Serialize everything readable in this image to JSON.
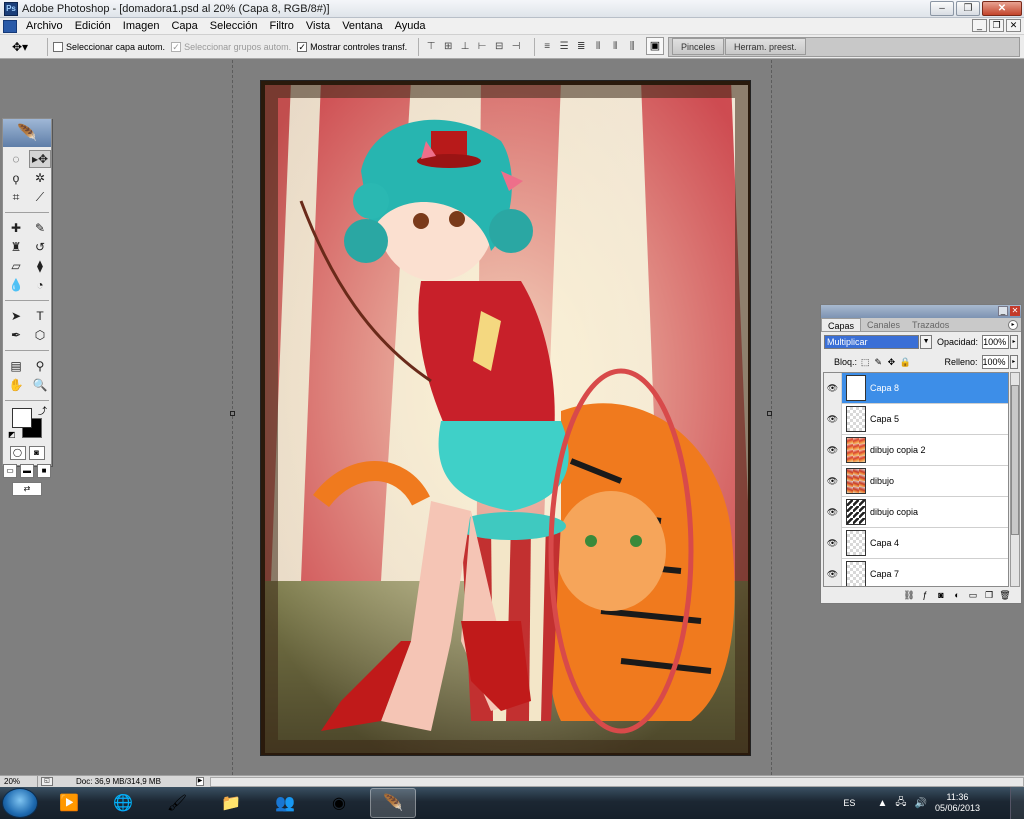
{
  "window": {
    "title": "Adobe Photoshop - [domadora1.psd al 20% (Capa 8, RGB/8#)]",
    "controls": [
      "–",
      "❐",
      "✕"
    ]
  },
  "menu": {
    "items": [
      "Archivo",
      "Edición",
      "Imagen",
      "Capa",
      "Selección",
      "Filtro",
      "Vista",
      "Ventana",
      "Ayuda"
    ],
    "doc_controls": [
      "_",
      "❐",
      "✕"
    ]
  },
  "options": {
    "auto_select_layer": "Seleccionar capa autom.",
    "auto_select_groups": "Seleccionar grupos autom.",
    "show_transform": "Mostrar controles transf.",
    "palette_tabs": [
      "Pinceles",
      "Herram. preest."
    ]
  },
  "layers_panel": {
    "tabs": [
      "Capas",
      "Canales",
      "Trazados"
    ],
    "blend_mode": "Multiplicar",
    "opacity_label": "Opacidad:",
    "opacity": "100%",
    "lock_label": "Bloq.:",
    "fill_label": "Relleno:",
    "fill": "100%",
    "layers": [
      {
        "name": "Capa 8",
        "selected": true,
        "thumb": "white"
      },
      {
        "name": "Capa 5",
        "selected": false,
        "thumb": "transparent"
      },
      {
        "name": "dibujo copia 2",
        "selected": false,
        "thumb": "art"
      },
      {
        "name": "dibujo",
        "selected": false,
        "thumb": "art2"
      },
      {
        "name": "dibujo copia",
        "selected": false,
        "thumb": "bw"
      },
      {
        "name": "Capa 4",
        "selected": false,
        "thumb": "transparent"
      },
      {
        "name": "Capa 7",
        "selected": false,
        "thumb": "transparent"
      }
    ]
  },
  "status": {
    "zoom": "20%",
    "doc": "Doc: 36,9 MB/314,9 MB"
  },
  "taskbar": {
    "lang": "ES",
    "time": "11:36",
    "date": "05/06/2013"
  },
  "colors": {
    "accent": "#3d8ee8",
    "foreground_swatch": "#ffffff",
    "background_swatch": "#000000"
  }
}
